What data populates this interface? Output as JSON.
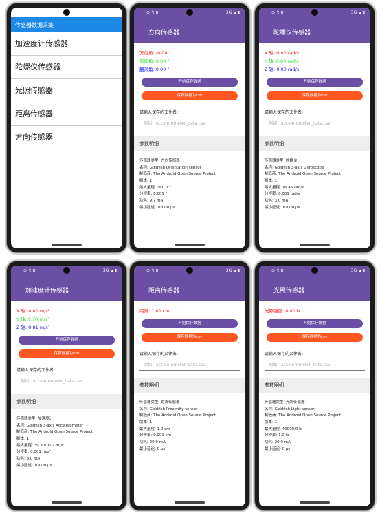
{
  "status": {
    "time": "⊙ ↯ ▮",
    "network": "3G ◢ ▮"
  },
  "list_screen": {
    "title": "传感器数据采集",
    "items": [
      "加速度计传感器",
      "陀螺仪传感器",
      "光照传感器",
      "距离传感器",
      "方向传感器"
    ]
  },
  "common": {
    "start_button": "开始保存数据",
    "save_button": "保存数据为csv",
    "filename_prompt": "请输入保存的文件名:",
    "filename_placeholder": "例如：accelerometer_data.csv",
    "section_title": "参数明细"
  },
  "colors": {
    "appbar": "#6a4fa5",
    "list_header": "#1e88e5",
    "save_button": "#ff5722",
    "red": "#ff1a1a",
    "green": "#25e025",
    "blue": "#1a1aff"
  },
  "screens": [
    {
      "title": "方向传感器",
      "readings": [
        {
          "text": "方位角: -0.08 °",
          "color": "red"
        },
        {
          "text": "俯仰角: 0.00 °",
          "color": "green"
        },
        {
          "text": "翻滚角: 0.00 °",
          "color": "blue"
        }
      ],
      "params": [
        "传感器类型: 方向传感器",
        "名称: Goldfish Orientation sensor",
        "制造商: The Android Open Source Project",
        "版本: 1",
        "最大量程: 360.0 °",
        "分辨率: 0.001 °",
        "功耗: 9.7 mA",
        "最小延迟: 10000 μs"
      ]
    },
    {
      "title": "陀螺仪传感器",
      "readings": [
        {
          "text": "X 轴: 0.00 rad/s",
          "color": "red"
        },
        {
          "text": "Y 轴: 0.00 rad/s",
          "color": "green"
        },
        {
          "text": "Z 轴: 0.00 rad/s",
          "color": "blue"
        }
      ],
      "params": [
        "传感器类型: 陀螺仪",
        "名称: Goldfish 3-axis Gyroscope",
        "制造商: The Android Open Source Project",
        "版本: 1",
        "最大量程: 16.46 rad/s",
        "分辨率: 0.001 rad/s",
        "功耗: 3.0 mA",
        "最小延迟: 10000 μs"
      ]
    },
    {
      "title": "加速度计传感器",
      "readings": [
        {
          "text": "X 轴: 0.00 m/s²",
          "color": "red"
        },
        {
          "text": "Y 轴: 9.78 m/s²",
          "color": "green"
        },
        {
          "text": "Z 轴: 0.81 m/s²",
          "color": "blue"
        }
      ],
      "params": [
        "传感器类型: 加速度计",
        "名称: Goldfish 3-axis Accelerometer",
        "制造商: The Android Open Source Project",
        "版本: 1",
        "最大量程: 39.300102 m/s²",
        "分辨率: 0.001 m/s²",
        "功耗: 3.0 mA",
        "最小延迟: 10000 μs"
      ]
    },
    {
      "title": "距离传感器",
      "readings": [
        {
          "text": "距离: 1.00 cm",
          "color": "red"
        }
      ],
      "params": [
        "传感器类型: 距离传感器",
        "名称: Goldfish Proximity sensor",
        "制造商: The Android Open Source Project",
        "版本: 1",
        "最大量程: 1.0 cm",
        "分辨率: 0.001 cm",
        "功耗: 20.0 mA",
        "最小延迟: 0 μs"
      ]
    },
    {
      "title": "光照传感器",
      "readings": [
        {
          "text": "光照强度: 0.00 lx",
          "color": "red"
        }
      ],
      "params": [
        "传感器类型: 光照传感器",
        "名称: Goldfish Light sensor",
        "制造商: The Android Open Source Project",
        "版本: 1",
        "最大量程: 40000.0 lx",
        "分辨率: 1.0 lx",
        "功耗: 20.0 mA",
        "最小延迟: 0 μs"
      ]
    }
  ]
}
